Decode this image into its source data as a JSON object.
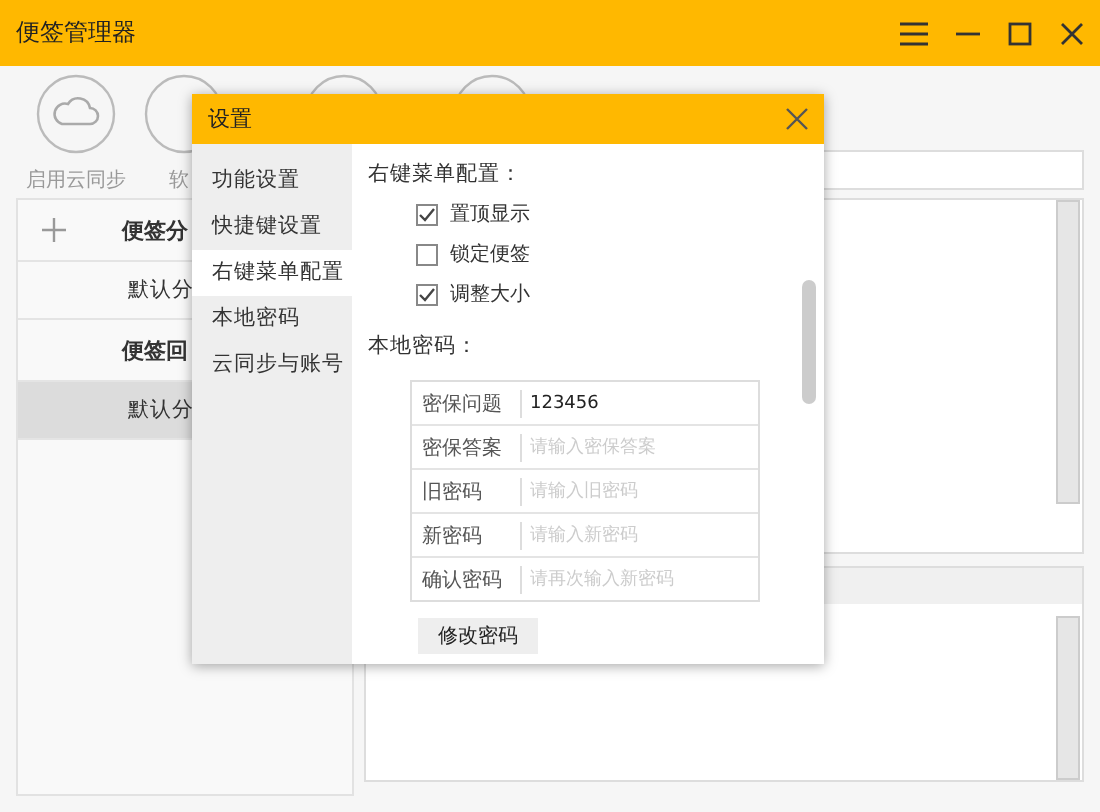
{
  "window": {
    "title": "便签管理器"
  },
  "toolbar": [
    {
      "label": "启用云同步"
    },
    {
      "label": "软"
    }
  ],
  "sidebar": {
    "groups": [
      {
        "title": "便签分",
        "items": [
          {
            "label": "默认分",
            "selected": false
          }
        ]
      },
      {
        "title": "便签回",
        "items": [
          {
            "label": "默认分",
            "selected": true
          }
        ]
      }
    ]
  },
  "dialog": {
    "title": "设置",
    "nav": [
      {
        "label": "功能设置",
        "selected": false
      },
      {
        "label": "快捷键设置",
        "selected": false
      },
      {
        "label": "右键菜单配置",
        "selected": true
      },
      {
        "label": "本地密码",
        "selected": false
      },
      {
        "label": "云同步与账号",
        "selected": false
      }
    ],
    "menu_heading": "右键菜单配置：",
    "menu_options": [
      {
        "label": "置顶显示",
        "checked": true
      },
      {
        "label": "锁定便签",
        "checked": false
      },
      {
        "label": "调整大小",
        "checked": true
      }
    ],
    "password_heading": "本地密码：",
    "password_fields": [
      {
        "label": "密保问题",
        "value": "123456"
      },
      {
        "label": "密保答案",
        "placeholder": "请输入密保答案"
      },
      {
        "label": "旧密码",
        "placeholder": "请输入旧密码"
      },
      {
        "label": "新密码",
        "placeholder": "请输入新密码"
      },
      {
        "label": "确认密码",
        "placeholder": "请再次输入新密码"
      }
    ],
    "button": "修改密码"
  }
}
